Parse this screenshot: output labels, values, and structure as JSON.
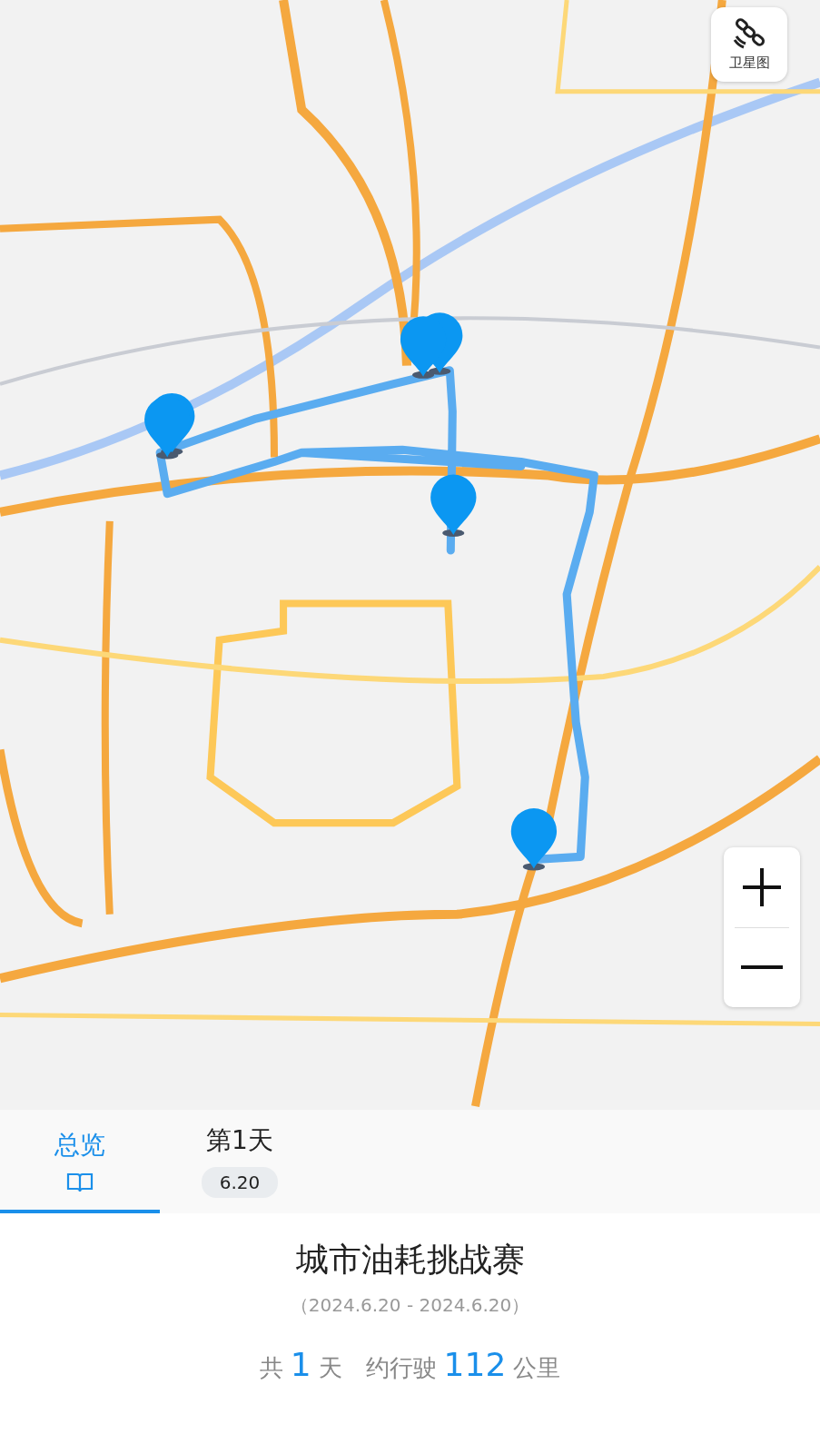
{
  "map_controls": {
    "satellite_label": "卫星图"
  },
  "tabs": [
    {
      "kind": "overview",
      "label": "总览",
      "selected": true
    },
    {
      "kind": "day",
      "label": "第1天",
      "date": "6.20",
      "selected": false
    }
  ],
  "trip": {
    "title": "城市油耗挑战赛",
    "date_range": "（2024.6.20 - 2024.6.20）",
    "summary": [
      {
        "kind": "text",
        "text": "共"
      },
      {
        "kind": "number",
        "text": "1"
      },
      {
        "kind": "text",
        "text": "天"
      },
      {
        "kind": "gap"
      },
      {
        "kind": "text",
        "text": "约行驶"
      },
      {
        "kind": "number",
        "text": "112"
      },
      {
        "kind": "text",
        "text": "公里"
      }
    ]
  }
}
